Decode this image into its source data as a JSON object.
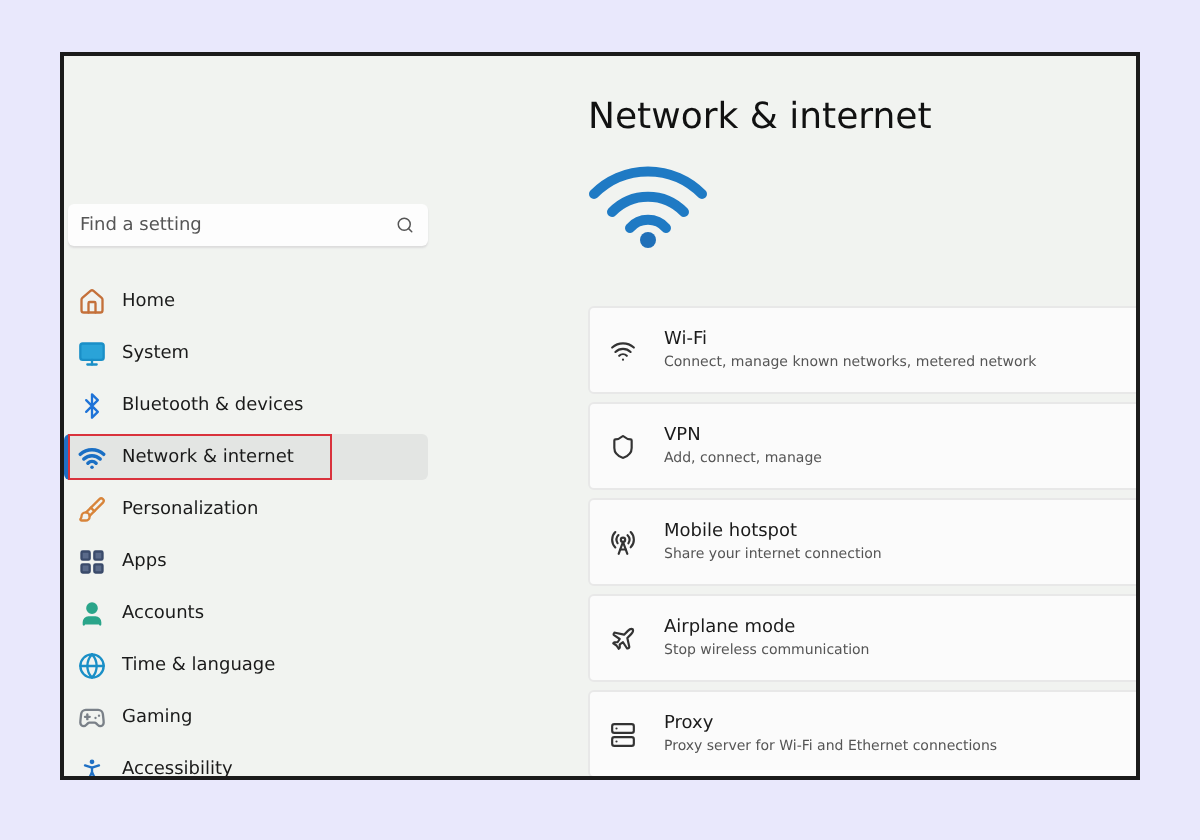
{
  "search": {
    "placeholder": "Find a setting"
  },
  "nav": [
    {
      "label": "Home",
      "selected": false,
      "highlighted": false
    },
    {
      "label": "System",
      "selected": false,
      "highlighted": false
    },
    {
      "label": "Bluetooth & devices",
      "selected": false,
      "highlighted": false
    },
    {
      "label": "Network & internet",
      "selected": true,
      "highlighted": true
    },
    {
      "label": "Personalization",
      "selected": false,
      "highlighted": false
    },
    {
      "label": "Apps",
      "selected": false,
      "highlighted": false
    },
    {
      "label": "Accounts",
      "selected": false,
      "highlighted": false
    },
    {
      "label": "Time & language",
      "selected": false,
      "highlighted": false
    },
    {
      "label": "Gaming",
      "selected": false,
      "highlighted": false
    },
    {
      "label": "Accessibility",
      "selected": false,
      "highlighted": false
    }
  ],
  "page": {
    "title": "Network & internet"
  },
  "cards": [
    {
      "title": "Wi-Fi",
      "subtitle": "Connect, manage known networks, metered network"
    },
    {
      "title": "VPN",
      "subtitle": "Add, connect, manage"
    },
    {
      "title": "Mobile hotspot",
      "subtitle": "Share your internet connection"
    },
    {
      "title": "Airplane mode",
      "subtitle": "Stop wireless communication"
    },
    {
      "title": "Proxy",
      "subtitle": "Proxy server for Wi-Fi and Ethernet connections"
    }
  ]
}
